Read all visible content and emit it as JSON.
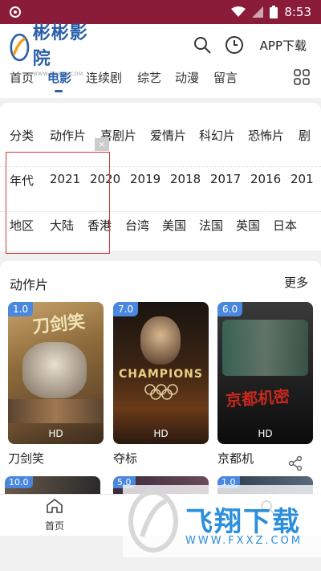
{
  "status": {
    "time": "8:53"
  },
  "header": {
    "logo_name": "彬彬影院",
    "logo_url": "WWW.BINBIN.COM",
    "app_download": "APP下载"
  },
  "nav": {
    "tabs": [
      "首页",
      "电影",
      "连续剧",
      "综艺",
      "动漫",
      "留言"
    ],
    "active": "电影"
  },
  "filters": {
    "category": [
      "分类",
      "动作片",
      "喜剧片",
      "爱情片",
      "科幻片",
      "恐怖片",
      "剧"
    ],
    "year": [
      "年代",
      "2021",
      "2020",
      "2019",
      "2018",
      "2017",
      "2016",
      "201"
    ],
    "region": [
      "地区",
      "大陆",
      "香港",
      "台湾",
      "美国",
      "法国",
      "英国",
      "日本"
    ],
    "ad_close": "×"
  },
  "section": {
    "title": "动作片",
    "more": "更多",
    "movies": [
      {
        "title": "刀剑笑",
        "score": "1.0",
        "badge": "HD",
        "poster_text": "刀剑笑"
      },
      {
        "title": "夺标",
        "score": "7.0",
        "badge": "HD",
        "poster_text": "CHAMPIONS"
      },
      {
        "title": "京都机",
        "score": "6.0",
        "badge": "HD",
        "poster_text": "京都机密"
      }
    ],
    "next_row_scores": [
      "10.0",
      "5.0",
      "1.0"
    ]
  },
  "bottom_nav": {
    "home": "首页"
  },
  "watermark": {
    "text": "飞翔下载",
    "url": "WWW.FXXZ.COM"
  },
  "colors": {
    "status_bar": "#8a1c3a",
    "brand": "#2b5fa8",
    "score_badge": "#4a88e0"
  }
}
